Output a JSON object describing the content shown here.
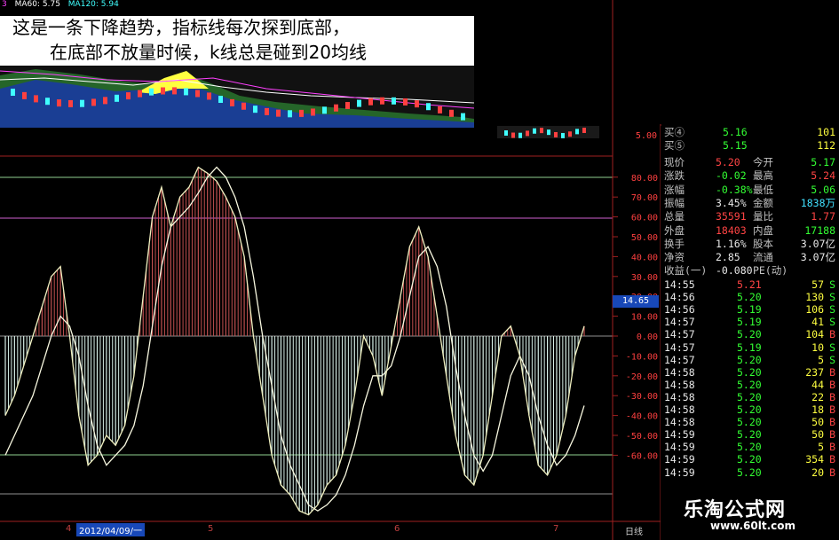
{
  "annotations": {
    "line1": "这是一条下降趋势，指标线每次探到底部，",
    "line2": "在底部不放量时候，k线总是碰到20均线"
  },
  "ma_legend": [
    "3",
    "MA60: 5.75",
    "MA120: 5.94"
  ],
  "price_axis_label": "5.00",
  "current_tag": "14.65",
  "quotes": {
    "buy4_label": "买④",
    "buy4_price": "5.16",
    "buy4_vol": "101",
    "buy5_label": "买⑤",
    "buy5_price": "5.15",
    "buy5_vol": "112",
    "rows": [
      {
        "l1": "现价",
        "v1": "5.20",
        "l2": "今开",
        "v2": "5.17"
      },
      {
        "l1": "涨跌",
        "v1": "-0.02",
        "l2": "最高",
        "v2": "5.24"
      },
      {
        "l1": "涨幅",
        "v1": "-0.38%",
        "l2": "最低",
        "v2": "5.06"
      },
      {
        "l1": "振幅",
        "v1": "3.45%",
        "l2": "金额",
        "v2": "1838万"
      },
      {
        "l1": "总量",
        "v1": "35591",
        "l2": "量比",
        "v2": "1.77"
      },
      {
        "l1": "外盘",
        "v1": "18403",
        "l2": "内盘",
        "v2": "17188"
      },
      {
        "l1": "换手",
        "v1": "1.16%",
        "l2": "股本",
        "v2": "3.07亿"
      },
      {
        "l1": "净资",
        "v1": "2.85",
        "l2": "流通",
        "v2": "3.07亿"
      },
      {
        "l1": "收益(一)",
        "v1": "-0.080",
        "l2": "PE(动)",
        "v2": ""
      }
    ],
    "ticks": [
      {
        "t": "14:55",
        "p": "5.21",
        "v": "57",
        "s": "S"
      },
      {
        "t": "14:56",
        "p": "5.20",
        "v": "130",
        "s": "S"
      },
      {
        "t": "14:56",
        "p": "5.19",
        "v": "106",
        "s": "S"
      },
      {
        "t": "14:57",
        "p": "5.19",
        "v": "41",
        "s": "S"
      },
      {
        "t": "14:57",
        "p": "5.20",
        "v": "104",
        "s": "B"
      },
      {
        "t": "14:57",
        "p": "5.19",
        "v": "10",
        "s": "S"
      },
      {
        "t": "14:57",
        "p": "5.20",
        "v": "5",
        "s": "S"
      },
      {
        "t": "14:58",
        "p": "5.20",
        "v": "237",
        "s": "B"
      },
      {
        "t": "14:58",
        "p": "5.20",
        "v": "44",
        "s": "B"
      },
      {
        "t": "14:58",
        "p": "5.20",
        "v": "22",
        "s": "B"
      },
      {
        "t": "14:58",
        "p": "5.20",
        "v": "18",
        "s": "B"
      },
      {
        "t": "14:58",
        "p": "5.20",
        "v": "50",
        "s": "B"
      },
      {
        "t": "14:59",
        "p": "5.20",
        "v": "50",
        "s": "B"
      },
      {
        "t": "14:59",
        "p": "5.20",
        "v": "5",
        "s": "B"
      },
      {
        "t": "14:59",
        "p": "5.20",
        "v": "354",
        "s": "B"
      },
      {
        "t": "14:59",
        "p": "5.20",
        "v": "20",
        "s": "B"
      }
    ]
  },
  "dates": {
    "d1": "4",
    "d2": "2012/04/09/一",
    "d3": "5",
    "d4": "6",
    "d5": "7",
    "period": "日线"
  },
  "watermark": {
    "cn": "乐淘公式网",
    "url": "www.60lt.com"
  },
  "colors": {
    "up": "#ff4444",
    "down": "#33ff33",
    "hist_pos": "#c05050",
    "hist_neg": "#d8f0e8",
    "fast": "#f0f0c0",
    "slow": "#f8f8e0"
  },
  "chart_data": {
    "type": "line",
    "ylim": [
      -70,
      90
    ],
    "yticks": [
      80,
      70,
      60,
      50,
      40,
      30,
      20,
      10,
      0,
      -10,
      -20,
      -30,
      -40,
      -50,
      -60
    ],
    "hlines": [
      80,
      60,
      0,
      -60,
      -80
    ],
    "series": [
      {
        "values": [
          -40,
          -30,
          -15,
          0,
          15,
          30,
          35,
          0,
          -40,
          -65,
          -60,
          -50,
          -55,
          -45,
          -20,
          20,
          60,
          75,
          55,
          70,
          75,
          85,
          82,
          78,
          70,
          60,
          40,
          0,
          -30,
          -60,
          -75,
          -80,
          -88,
          -90,
          -85,
          -75,
          -70,
          -55,
          -30,
          0,
          -10,
          -30,
          -5,
          20,
          45,
          55,
          40,
          10,
          -20,
          -50,
          -70,
          -75,
          -60,
          -30,
          0,
          5,
          -10,
          -40,
          -65,
          -70,
          -60,
          -40,
          -10,
          5
        ]
      },
      {
        "values": [
          -60,
          -50,
          -40,
          -30,
          -15,
          0,
          10,
          5,
          -10,
          -35,
          -55,
          -65,
          -60,
          -55,
          -45,
          -25,
          5,
          35,
          55,
          60,
          65,
          72,
          80,
          85,
          80,
          70,
          55,
          30,
          0,
          -25,
          -50,
          -65,
          -75,
          -85,
          -88,
          -85,
          -80,
          -70,
          -55,
          -35,
          -20,
          -20,
          -15,
          0,
          20,
          40,
          45,
          35,
          15,
          -15,
          -40,
          -60,
          -68,
          -60,
          -40,
          -20,
          -10,
          -20,
          -40,
          -55,
          -65,
          -60,
          -50,
          -35
        ]
      }
    ]
  }
}
